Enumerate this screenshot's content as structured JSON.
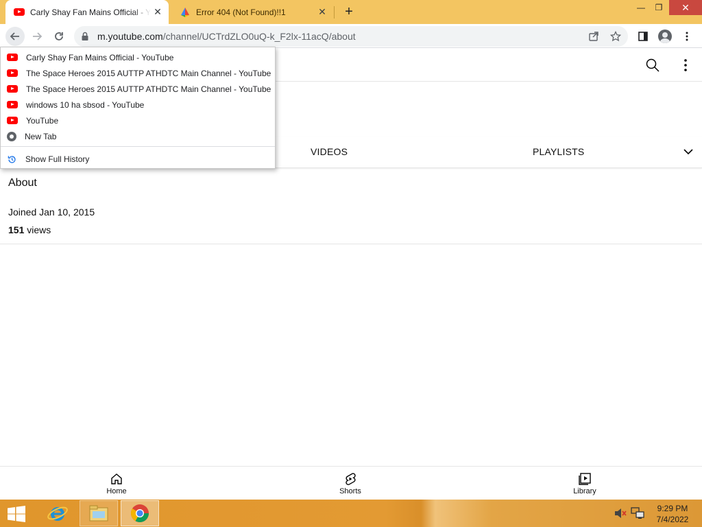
{
  "browser": {
    "tabs": [
      {
        "title": "Carly Shay Fan Mains Official - YouTube",
        "active": true,
        "favicon": "youtube-icon"
      },
      {
        "title": "Error 404 (Not Found)!!1",
        "active": false,
        "favicon": "google-icon"
      }
    ],
    "url_host": "m.youtube.com",
    "url_path": "/channel/UCTrdZLO0uQ-k_F2lx-11acQ/about",
    "colors": {
      "frame": "#f3c561",
      "omnibox": "#f1f3f4"
    }
  },
  "history_menu": {
    "items": [
      {
        "label": "Carly Shay Fan Mains Official - YouTube",
        "icon": "youtube-icon"
      },
      {
        "label": "The Space Heroes 2015 AUTTP ATHDTC Main Channel - YouTube",
        "icon": "youtube-icon"
      },
      {
        "label": "The Space Heroes 2015 AUTTP ATHDTC Main Channel - YouTube",
        "icon": "youtube-icon"
      },
      {
        "label": "windows 10 ha sbsod - YouTube",
        "icon": "youtube-icon"
      },
      {
        "label": "YouTube",
        "icon": "youtube-icon"
      },
      {
        "label": "New Tab",
        "icon": "chrome-icon"
      }
    ],
    "show_full_history": "Show Full History"
  },
  "channel": {
    "tabs": [
      "VIDEOS",
      "PLAYLISTS"
    ],
    "about_heading": "About",
    "joined": "Joined Jan 10, 2015",
    "views_count": "151",
    "views_suffix": " views"
  },
  "pivot_bar": [
    {
      "label": "Home",
      "icon": "home-icon"
    },
    {
      "label": "Shorts",
      "icon": "shorts-icon"
    },
    {
      "label": "Library",
      "icon": "library-icon"
    }
  ],
  "taskbar": {
    "time": "9:29 PM",
    "date": "7/4/2022",
    "color": "#e39a33"
  }
}
